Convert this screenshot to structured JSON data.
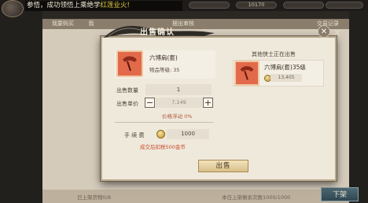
{
  "topbar": {
    "broadcast_prefix": "参悟，",
    "broadcast_text": "成功领悟上乘绝学",
    "broadcast_highlight": "红莲业火!",
    "resources": [
      "",
      "10170",
      "",
      ""
    ]
  },
  "market": {
    "tabs": [
      "我要购买",
      "我",
      "",
      "摆出审核",
      "交易记录"
    ],
    "footer_left": "已上架货物0/8",
    "footer_right": "本日上架剩余次数1000/1000",
    "shelve_label": "下架"
  },
  "dialog": {
    "title": "出售确认",
    "item": {
      "name": "六博肩(套)",
      "level_label": "物品等级:",
      "level": "35",
      "icon": "shoulder-armor-icon"
    },
    "quantity_label": "出售数量",
    "quantity": "1",
    "price_label": "出售单价",
    "price": "7,149",
    "float_label": "价格浮动",
    "float_value": "0%",
    "fee_label": "手 续 费",
    "fee": "1000",
    "fee_note": "成交后扣税500金币",
    "sell_label": "出售",
    "others": {
      "title": "其他侠士正在出售",
      "name": "六博肩(套)35级",
      "price": "13,405"
    }
  },
  "colors": {
    "accent_red": "#c84b2f",
    "highlight_yellow": "#e9d044",
    "item_red": "#e26a4a"
  }
}
